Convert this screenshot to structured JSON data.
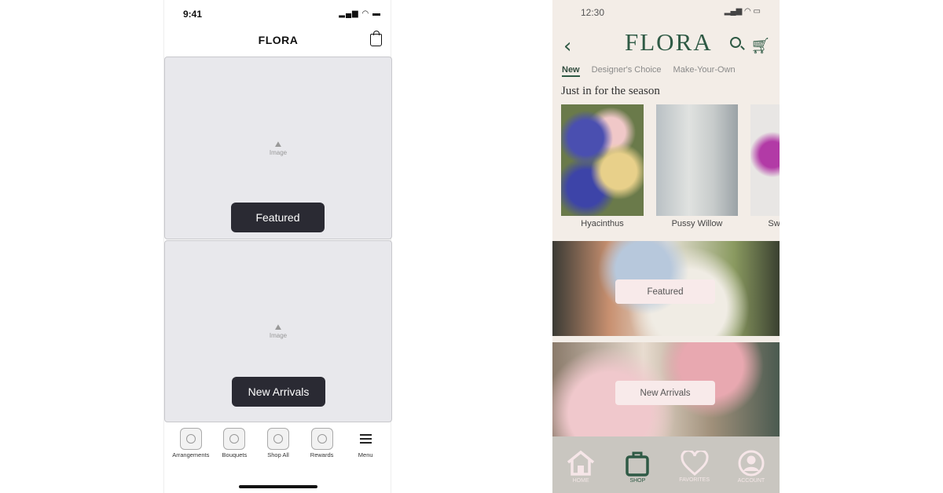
{
  "wireframe": {
    "status_time": "9:41",
    "title": "FLORA",
    "cards": [
      {
        "placeholder": "Image",
        "button": "Featured"
      },
      {
        "placeholder": "Image",
        "button": "New Arrivals"
      }
    ],
    "nav": [
      {
        "label": "Arrangements"
      },
      {
        "label": "Bouquets"
      },
      {
        "label": "Shop All"
      },
      {
        "label": "Rewards"
      },
      {
        "label": "Menu",
        "icon": "menu-icon"
      }
    ]
  },
  "mockup": {
    "status_time": "12:30",
    "logo": "FLORA",
    "tabs": [
      {
        "label": "New",
        "active": true
      },
      {
        "label": "Designer's Choice"
      },
      {
        "label": "Make-Your-Own"
      }
    ],
    "section_title": "Just in for the season",
    "products": [
      {
        "name": "Hyacinthus"
      },
      {
        "name": "Pussy Willow"
      },
      {
        "name": "Sw"
      }
    ],
    "banners": [
      {
        "button": "Featured"
      },
      {
        "button": "New Arrivals"
      }
    ],
    "nav": [
      {
        "label": "HOME",
        "icon": "home-icon"
      },
      {
        "label": "SHOP",
        "icon": "shopping-bag-icon",
        "active": true
      },
      {
        "label": "FAVORITES",
        "icon": "heart-icon"
      },
      {
        "label": "ACCOUNT",
        "icon": "account-icon"
      }
    ],
    "colors": {
      "brand": "#2f5a45",
      "background": "#f3ede7",
      "nav": "#c9c6c0",
      "button": "#f8eaea"
    }
  }
}
